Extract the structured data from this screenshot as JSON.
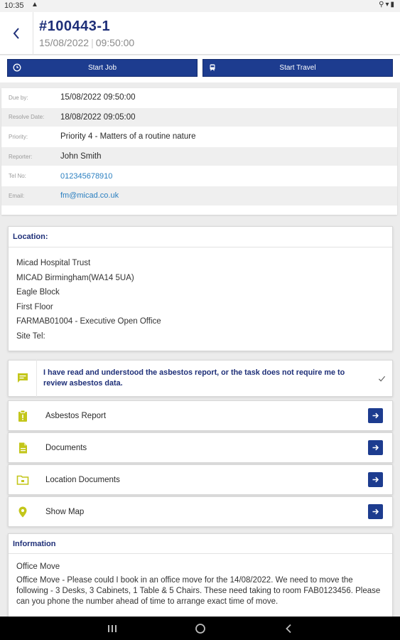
{
  "status": {
    "time": "10:35"
  },
  "header": {
    "job_number": "#100443-1",
    "date": "15/08/2022",
    "time": "09:50:00"
  },
  "actions": {
    "start_job": "Start Job",
    "start_travel": "Start Travel"
  },
  "details": [
    {
      "label": "Due by:",
      "value": "15/08/2022 09:50:00"
    },
    {
      "label": "Resolve Date:",
      "value": "18/08/2022 09:05:00"
    },
    {
      "label": "Priority:",
      "value": "Priority 4 - Matters of a routine nature"
    },
    {
      "label": "Reporter:",
      "value": "John Smith"
    },
    {
      "label": "Tel No:",
      "value": "012345678910"
    },
    {
      "label": "Email:",
      "value": "fm@micad.co.uk"
    }
  ],
  "location": {
    "title": "Location:",
    "lines": [
      "Micad Hospital Trust",
      "MICAD Birmingham(WA14 5UA)",
      "Eagle Block",
      "First Floor",
      "FARMAB01004 - Executive Open Office",
      "Site Tel:"
    ]
  },
  "asbestos_ack": {
    "text": "I have read and understood the asbestos report, or the task does not require me to review asbestos data."
  },
  "links": [
    {
      "label": "Asbestos Report",
      "icon": "clipboard-icon"
    },
    {
      "label": "Documents",
      "icon": "document-icon"
    },
    {
      "label": "Location Documents",
      "icon": "folder-icon"
    },
    {
      "label": "Show Map",
      "icon": "map-pin-icon"
    }
  ],
  "information": {
    "title": "Information",
    "subject": "Office Move",
    "text": "Office Move - Please could I book in an office move for the 14/08/2022. We need to move the following - 3 Desks, 3 Cabinets, 1 Table & 5 Chairs. These need taking to room FAB0123456. Please can you phone the number ahead of time to arrange exact time of move."
  },
  "colors": {
    "accent": "#1d3c8f",
    "title": "#1e2f78",
    "icon": "#c3c61a",
    "link": "#2a7fc0"
  }
}
